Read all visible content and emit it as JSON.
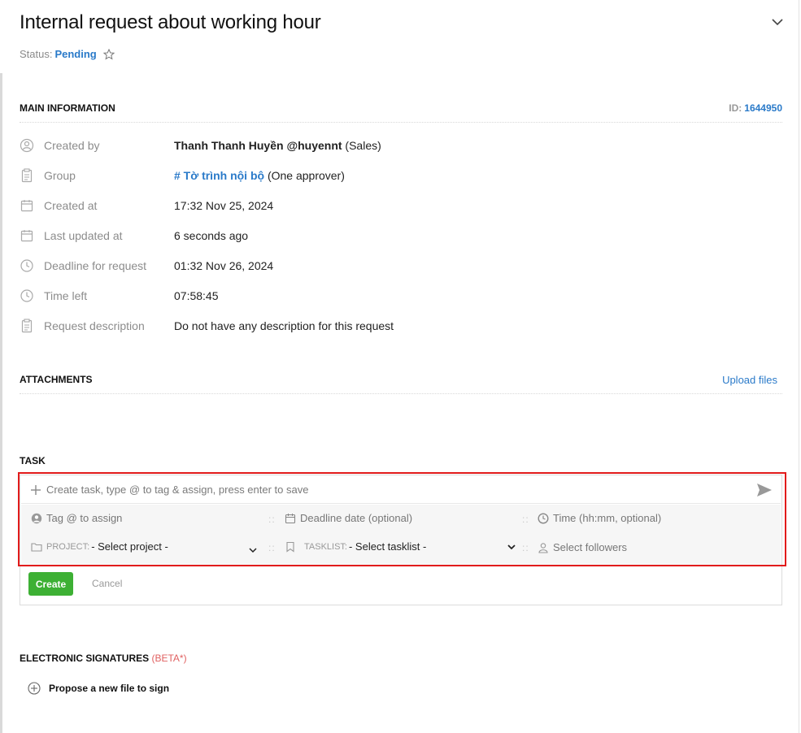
{
  "header": {
    "title": "Internal request about working hour",
    "status_label": "Status:",
    "status_value": "Pending"
  },
  "main_info": {
    "heading": "MAIN INFORMATION",
    "id_label": "ID:",
    "id_value": "1644950",
    "rows": [
      {
        "label": "Created by",
        "value_name": "Thanh Thanh Huyền @huyennt",
        "value_extra": " (Sales)",
        "icon": "user-icon"
      },
      {
        "label": "Group",
        "value_link": "# Tờ trình nội bộ",
        "value_extra": " (One approver)",
        "icon": "clipboard-icon"
      },
      {
        "label": "Created at",
        "value": "17:32 Nov 25, 2024",
        "icon": "calendar-icon"
      },
      {
        "label": "Last updated at",
        "value": "6 seconds ago",
        "icon": "calendar-icon"
      },
      {
        "label": "Deadline for request",
        "value": "01:32 Nov 26, 2024",
        "icon": "clock-icon"
      },
      {
        "label": "Time left",
        "value": "07:58:45",
        "icon": "clock-icon"
      },
      {
        "label": "Request description",
        "value": "Do not have any description for this request",
        "icon": "clipboard-icon"
      }
    ]
  },
  "attachments": {
    "heading": "ATTACHMENTS",
    "upload_label": "Upload files"
  },
  "task": {
    "heading": "TASK",
    "input_placeholder": "Create task, type @ to tag & assign, press enter to save",
    "tag_assign": "Tag @ to assign",
    "deadline_date": "Deadline date (optional)",
    "time": "Time (hh:mm, optional)",
    "project_label": "PROJECT:",
    "project_value": "- Select project -",
    "tasklist_label": "TASKLIST:",
    "tasklist_value": "- Select tasklist -",
    "followers": "Select followers",
    "create_label": "Create",
    "cancel_label": "Cancel"
  },
  "signatures": {
    "heading": "ELECTRONIC SIGNATURES",
    "beta": "(BETA*)",
    "propose_label": "Propose a new file to sign"
  },
  "colors": {
    "accent": "#2a7ac9",
    "success": "#3db034",
    "highlight_border": "#e21b1b"
  }
}
